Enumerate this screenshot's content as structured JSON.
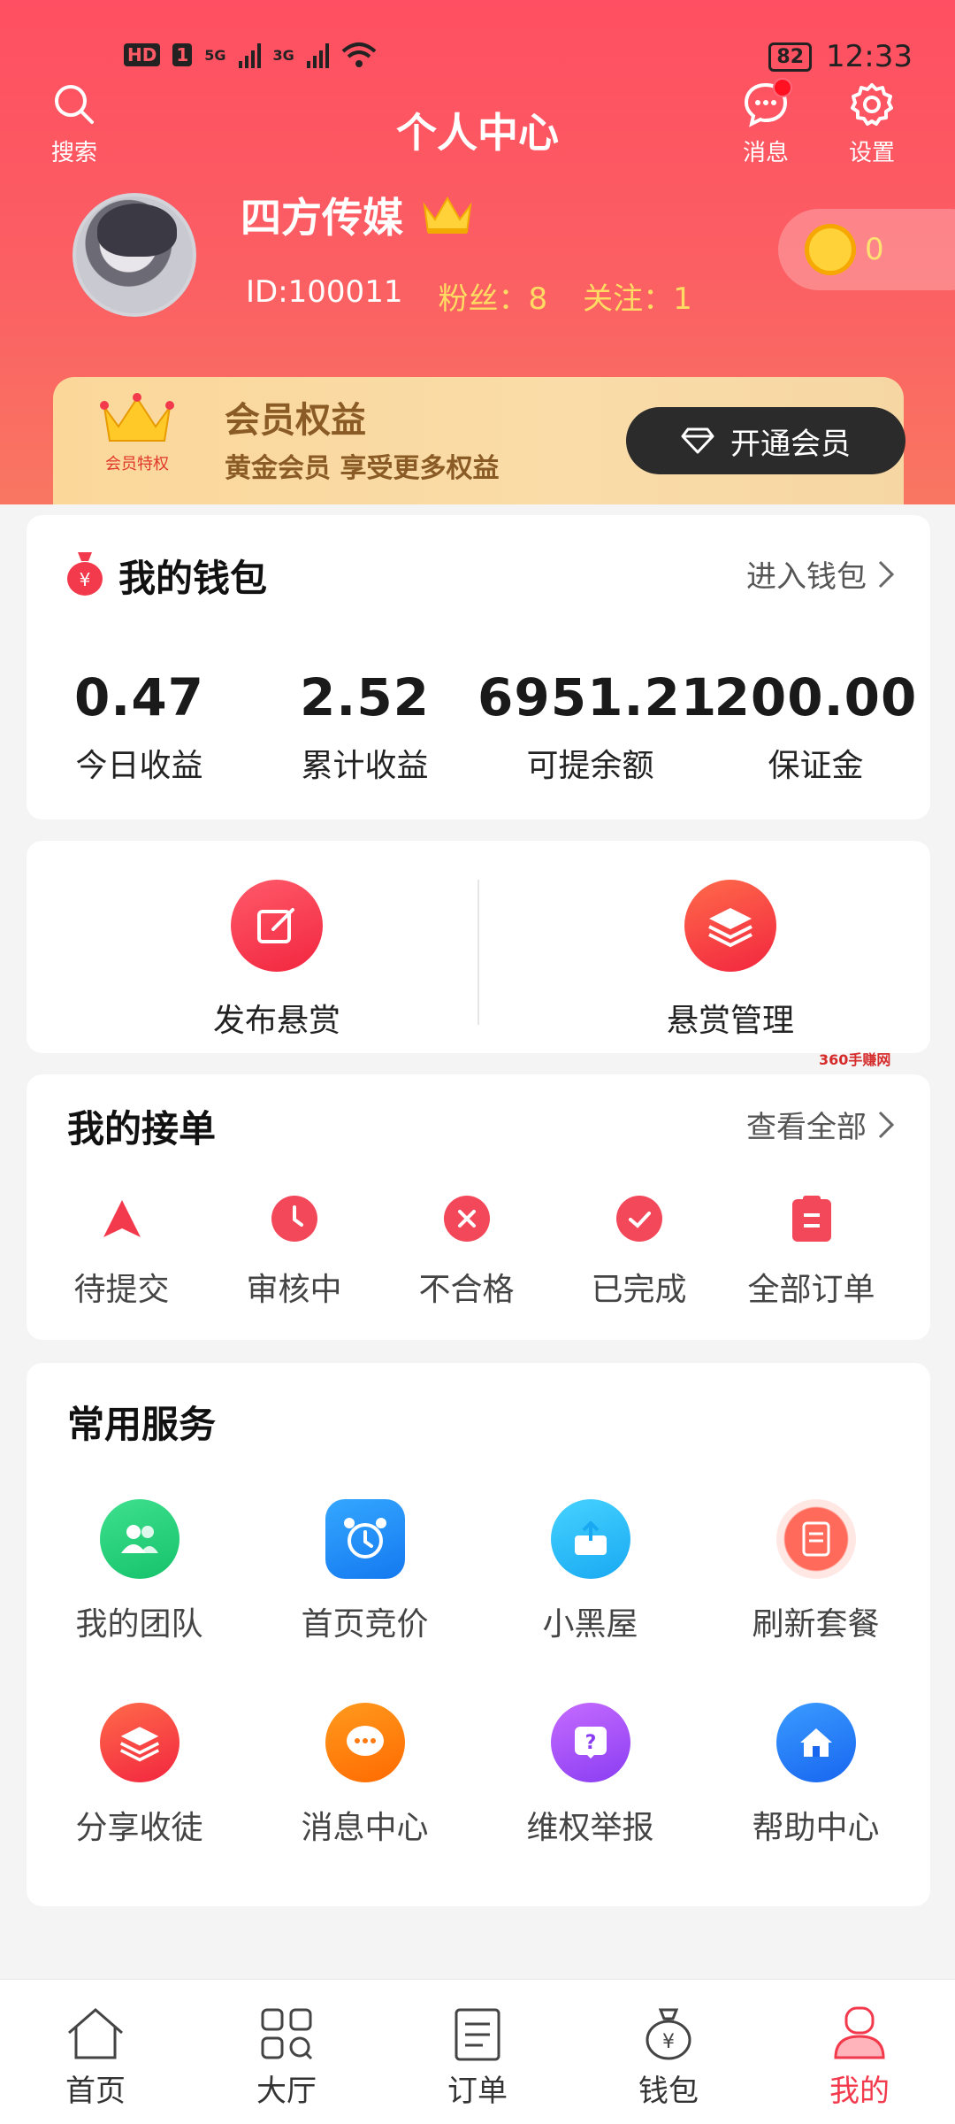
{
  "status_bar": {
    "left_chips": [
      "HD",
      "1"
    ],
    "signal_1": "5G",
    "signal_2": "3G",
    "battery": "82",
    "time": "12:33"
  },
  "header": {
    "title": "个人中心",
    "search_label": "搜索",
    "message_label": "消息",
    "settings_label": "设置"
  },
  "profile": {
    "name": "四方传媒",
    "id": "ID:100011",
    "fans": "粉丝：8",
    "following": "关注：1",
    "coins": "0"
  },
  "member": {
    "badge": "会员特权",
    "title": "会员权益",
    "subtitle": "黄金会员 享受更多权益",
    "button": "开通会员"
  },
  "wallet": {
    "title": "我的钱包",
    "link": "进入钱包",
    "items": [
      {
        "value": "0.47",
        "label": "今日收益"
      },
      {
        "value": "2.52",
        "label": "累计收益"
      },
      {
        "value": "6951.21",
        "label": "可提余额"
      },
      {
        "value": "200.00",
        "label": "保证金"
      }
    ]
  },
  "reward": {
    "publish": "发布悬赏",
    "manage": "悬赏管理"
  },
  "orders": {
    "title": "我的接单",
    "link": "查看全部",
    "items": [
      "待提交",
      "审核中",
      "不合格",
      "已完成",
      "全部订单"
    ]
  },
  "services": {
    "title": "常用服务",
    "items": [
      "我的团队",
      "首页竞价",
      "小黑屋",
      "刷新套餐",
      "分享收徒",
      "消息中心",
      "维权举报",
      "帮助中心"
    ]
  },
  "watermark": "360手赚网",
  "tabs": [
    "首页",
    "大厅",
    "订单",
    "钱包",
    "我的"
  ],
  "colors": {
    "primary": "#f23a4c",
    "header": "#ff4f62",
    "gold": "#ffdb63"
  }
}
